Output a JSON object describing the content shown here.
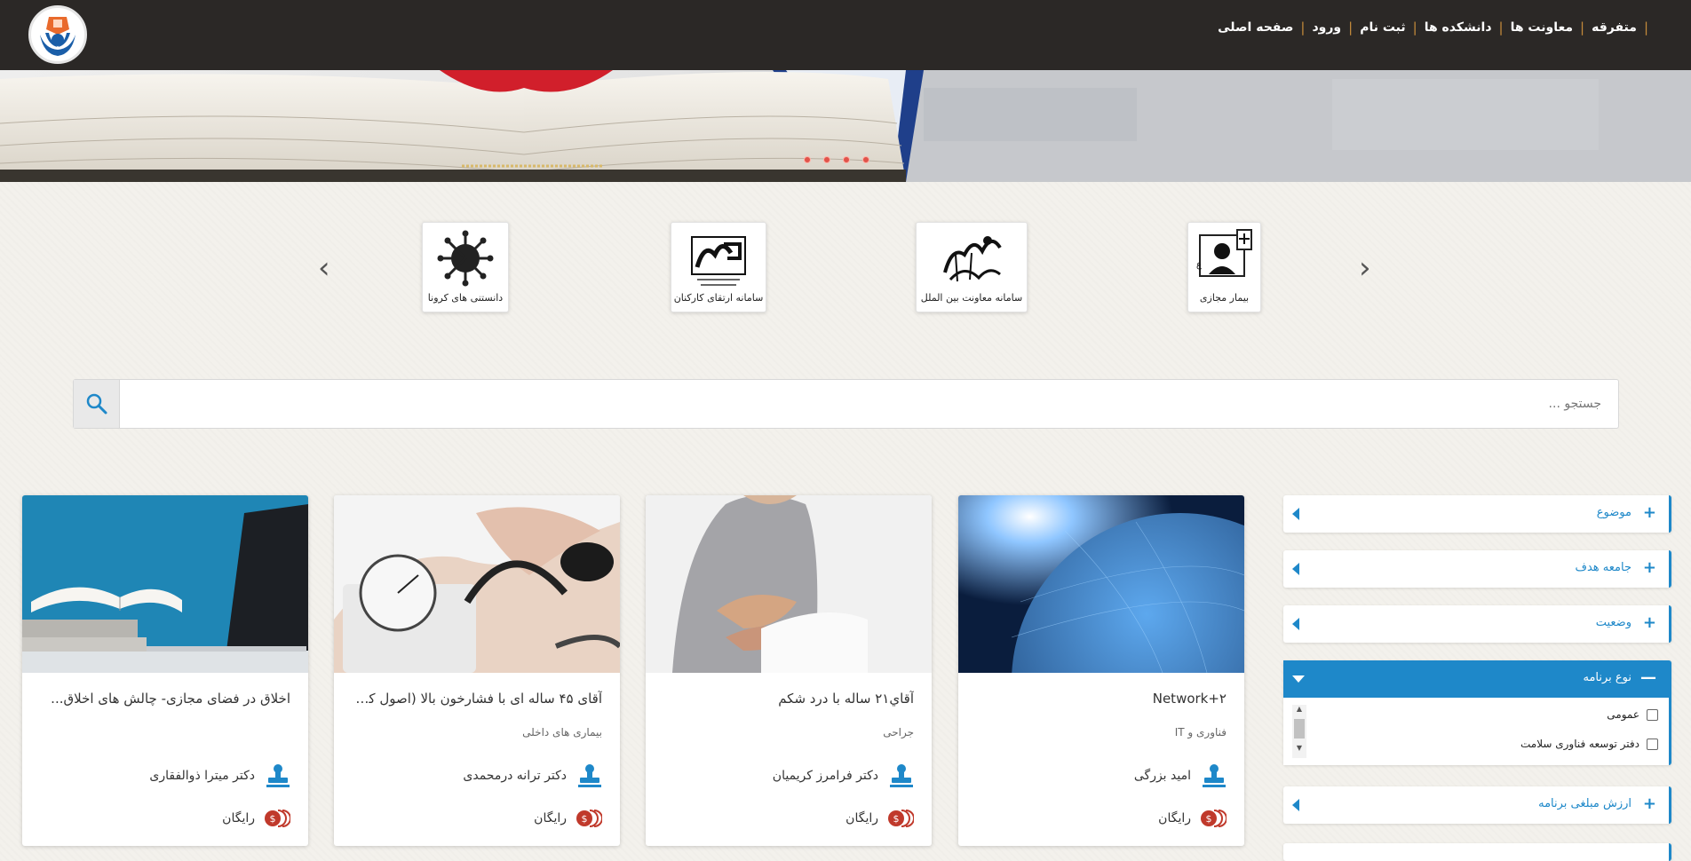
{
  "nav": {
    "items": [
      "صفحه اصلی",
      "ورود",
      "ثبت نام",
      "دانشکده ها",
      "معاونت ها",
      "متفرقه"
    ]
  },
  "quick_access": [
    {
      "label": "بیمار مجازی",
      "icon": "virtual-patient-icon"
    },
    {
      "label": "سامانه معاونت بین الملل",
      "icon": "international-logo-icon"
    },
    {
      "label": "سامانه ارتقای کارکنان",
      "icon": "staff-training-logo-icon"
    },
    {
      "label": "دانستنی های کرونا",
      "icon": "virus-icon"
    }
  ],
  "search": {
    "placeholder": "جستجو ..."
  },
  "courses": [
    {
      "title": "Network+۲",
      "category": "فناوری و IT",
      "teacher": "امید بزرگی",
      "price": "رایگان"
    },
    {
      "title": "آقاي۲۱ ساله با درد شکم",
      "category": "جراحی",
      "teacher": "دکتر فرامرز کریمیان",
      "price": "رایگان"
    },
    {
      "title": "آقای ۴۵ ساله ای با فشارخون بالا (اصول کل...",
      "category": "بیماری های داخلی",
      "teacher": "دکتر ترانه درمحمدی",
      "price": "رایگان"
    },
    {
      "title": "اخلاق در فضای مجازی- چالش های اخلاق...",
      "category": "",
      "teacher": "دکتر میترا ذوالفقاری",
      "price": "رایگان"
    }
  ],
  "filters": {
    "subject": "موضوع",
    "audience": "جامعه هدف",
    "status": "وضعیت",
    "program_type": "نوع برنامه",
    "program_type_options": [
      "عمومی",
      "دفتر توسعه فناوری سلامت"
    ],
    "price_value": "ارزش مبلغی برنامه",
    "collapsed_symbol": "+",
    "expanded_symbol": "—"
  },
  "colors": {
    "topbar": "#2b2826",
    "accent": "#1e88c9",
    "nav_separator": "#c58b3a",
    "price_icon": "#c0392b"
  }
}
